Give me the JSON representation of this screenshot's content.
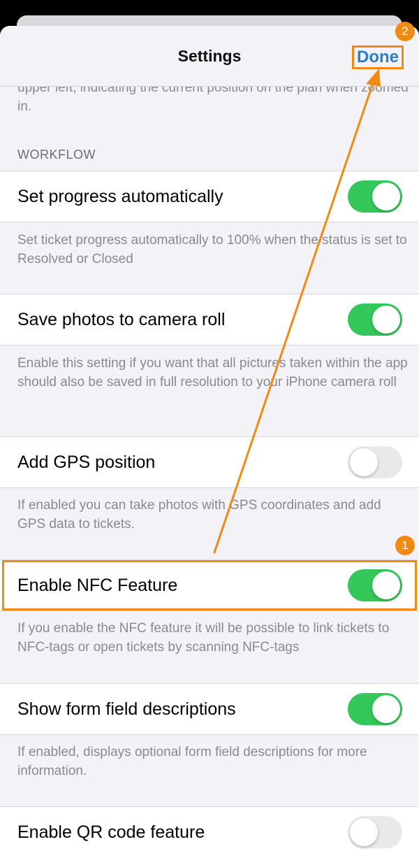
{
  "header": {
    "title": "Settings",
    "done_label": "Done"
  },
  "top_description": "upper left, indicating the current position on the plan when zoomed in.",
  "workflow": {
    "section_title": "WORKFLOW",
    "settings": [
      {
        "label": "Set progress automatically",
        "enabled": true,
        "description": "Set ticket progress automatically to 100% when the status is set to Resolved or Closed"
      },
      {
        "label": "Save photos to camera roll",
        "enabled": true,
        "description": "Enable this setting if you want that all pictures taken within the app should also be saved in full resolution to your iPhone camera roll"
      },
      {
        "label": "Add GPS position",
        "enabled": false,
        "description": "If enabled you can take photos with GPS coordinates and add GPS data to tickets."
      },
      {
        "label": "Enable NFC Feature",
        "enabled": true,
        "description": "If you enable the NFC feature it will be possible to link tickets to NFC-tags or open tickets by scanning NFC-tags"
      },
      {
        "label": "Show form field descriptions",
        "enabled": true,
        "description": "If enabled, displays optional form field descriptions for more information."
      },
      {
        "label": "Enable QR code feature",
        "enabled": false
      }
    ]
  },
  "annotations": {
    "step1": "1",
    "step2": "2",
    "accent_color": "#f08a12"
  },
  "colors": {
    "toggle_on": "#34c759",
    "toggle_off": "#e9e9eb",
    "link": "#2a7fd0"
  }
}
